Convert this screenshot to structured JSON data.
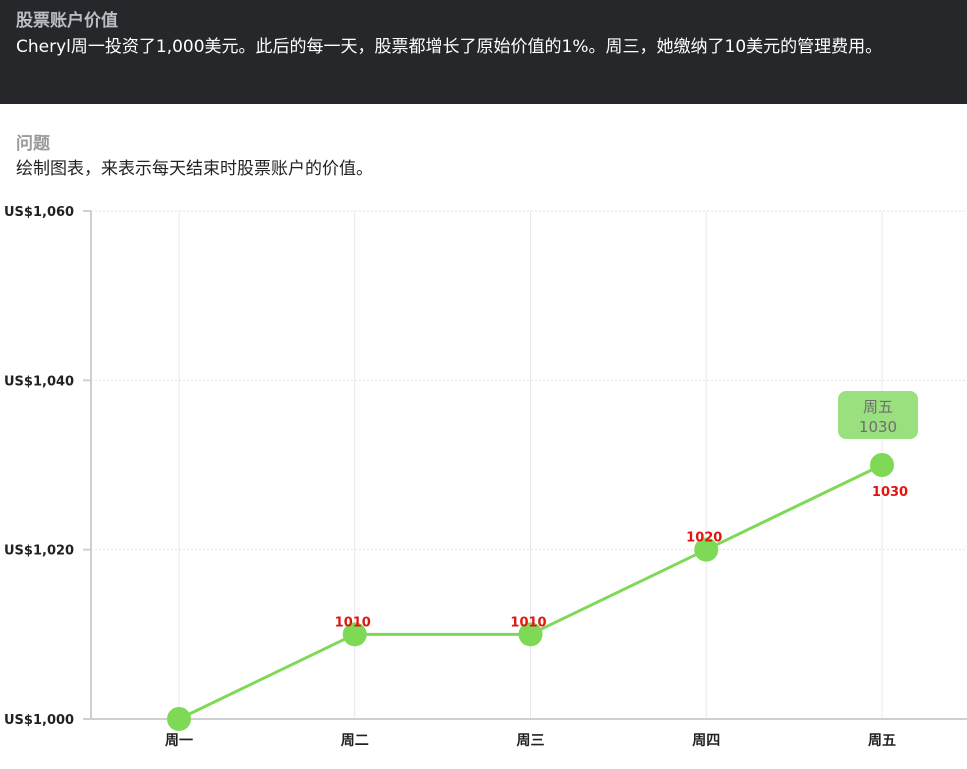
{
  "header": {
    "title": "股票账户价值",
    "text": "Cheryl周一投资了1,000美元。此后的每一天，股票都增长了原始价值的1%。周三，她缴纳了10美元的管理费用。"
  },
  "question": {
    "label": "问题",
    "text": "绘制图表，来表示每天结束时股票账户的价值。"
  },
  "tooltip": {
    "category": "周五",
    "value": "1030"
  },
  "colors": {
    "line": "#7ed957",
    "point": "#7ed957",
    "data_label": "#e1140f",
    "tooltip_bg": "#9be07f",
    "banner_bg": "#25272a"
  },
  "chart_data": {
    "type": "line",
    "categories": [
      "周一",
      "周二",
      "周三",
      "周四",
      "周五"
    ],
    "values": [
      1000,
      1010,
      1010,
      1020,
      1030
    ],
    "data_labels": [
      "",
      "1010",
      "1010",
      "1020",
      "1030"
    ],
    "ylim": [
      1000,
      1060
    ],
    "yticks": [
      1000,
      1020,
      1040,
      1060
    ],
    "ytick_labels": [
      "US$1,000",
      "US$1,020",
      "US$1,040",
      "US$1,060"
    ],
    "grid": true,
    "title": "",
    "xlabel": "",
    "ylabel": ""
  }
}
